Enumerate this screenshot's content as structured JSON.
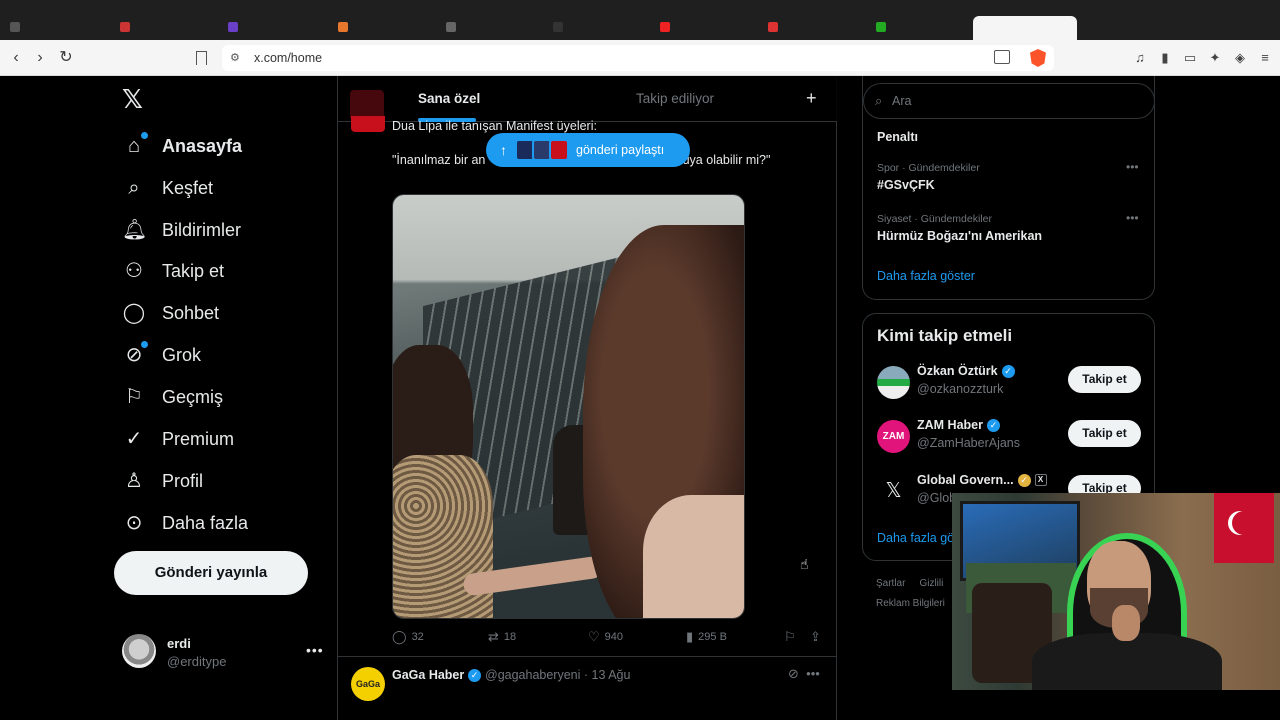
{
  "browser": {
    "url": "x.com/home"
  },
  "nav": {
    "items": [
      {
        "label": "Anasayfa",
        "icon": "home-icon"
      },
      {
        "label": "Keşfet",
        "icon": "search-icon"
      },
      {
        "label": "Bildirimler",
        "icon": "bell-icon"
      },
      {
        "label": "Takip et",
        "icon": "follow-icon"
      },
      {
        "label": "Sohbet",
        "icon": "chat-icon"
      },
      {
        "label": "Grok",
        "icon": "grok-icon"
      },
      {
        "label": "Geçmiş",
        "icon": "bookmark-icon"
      },
      {
        "label": "Premium",
        "icon": "premium-icon"
      },
      {
        "label": "Profil",
        "icon": "profile-icon"
      },
      {
        "label": "Daha fazla",
        "icon": "more-icon"
      }
    ],
    "post_button": "Gönderi yayınla",
    "account": {
      "name": "erdi",
      "handle": "@erditype"
    }
  },
  "feed": {
    "tabs": [
      "Sana özel",
      "Takip ediliyor"
    ],
    "tweet1": {
      "line1": "Dua Lipa ile tanışan Manifest üyeleri:",
      "line2a": "\"İnanılmaz bir an",
      "line2b": "uttum. Rüya olabilir mi?\"",
      "stats": {
        "replies": "32",
        "retweets": "18",
        "likes": "940",
        "views": "295 B"
      }
    },
    "new_posts_pill": "gönderi paylaştı",
    "tweet2": {
      "name": "GaGa Haber",
      "handle": "@gagahaberyeni · 13 Ağu",
      "avatar_text": "GaGa"
    }
  },
  "right": {
    "search_placeholder": "Ara",
    "trends": [
      {
        "meta": "",
        "title": "Penaltı"
      },
      {
        "meta": "Spor · Gündemdekiler",
        "title": "#GSvÇFK"
      },
      {
        "meta": "Siyaset · Gündemdekiler",
        "title": "Hürmüz Boğazı'nı Amerikan"
      }
    ],
    "trends_more": "Daha fazla göster",
    "who_title": "Kimi takip etmeli",
    "who": [
      {
        "name": "Özkan Öztürk",
        "handle": "@ozkanozzturk",
        "button": "Takip et"
      },
      {
        "name": "ZAM Haber",
        "handle": "@ZamHaberAjans",
        "button": "Takip et",
        "avatar_text": "ZAM"
      },
      {
        "name": "Global Govern...",
        "handle": "@Glob",
        "button": "Takip et"
      }
    ],
    "who_more": "Daha fazla gö",
    "footer": [
      "Şartlar",
      "Gizlili"
    ],
    "footer2": "Reklam Bilgileri"
  },
  "colors": {
    "accent": "#1d9bf0",
    "background": "#000000",
    "border": "#2f3336",
    "muted": "#71767b"
  }
}
